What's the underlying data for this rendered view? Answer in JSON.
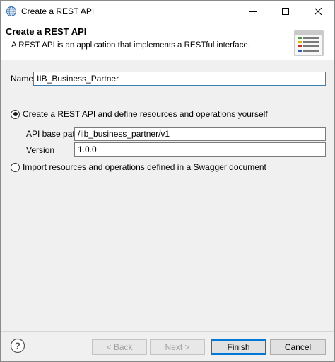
{
  "window": {
    "title": "Create a REST API",
    "controls": [
      "minimize",
      "maximize",
      "close"
    ]
  },
  "header": {
    "title": "Create a REST API",
    "description": "A REST API is an application that implements a RESTful interface.",
    "icon": "rest-api-wizard-icon"
  },
  "form": {
    "name_label": "Name",
    "name_value": "IIB_Business_Partner",
    "option_create_label": "Create a REST API and define resources and operations yourself",
    "option_create_selected": true,
    "base_path_label": "API base path",
    "base_path_value": "/iib_business_partner/v1",
    "version_label": "Version",
    "version_value": "1.0.0",
    "option_import_label": "Import resources and operations defined in a Swagger document",
    "option_import_selected": false
  },
  "footer": {
    "help_icon": "help-icon",
    "back_label": "< Back",
    "next_label": "Next >",
    "finish_label": "Finish",
    "cancel_label": "Cancel"
  },
  "colors": {
    "dialog_bg": "#f0f0f0",
    "header_bg": "#ffffff",
    "focus_border": "#3c7fb1",
    "default_button_border": "#0078d7"
  }
}
